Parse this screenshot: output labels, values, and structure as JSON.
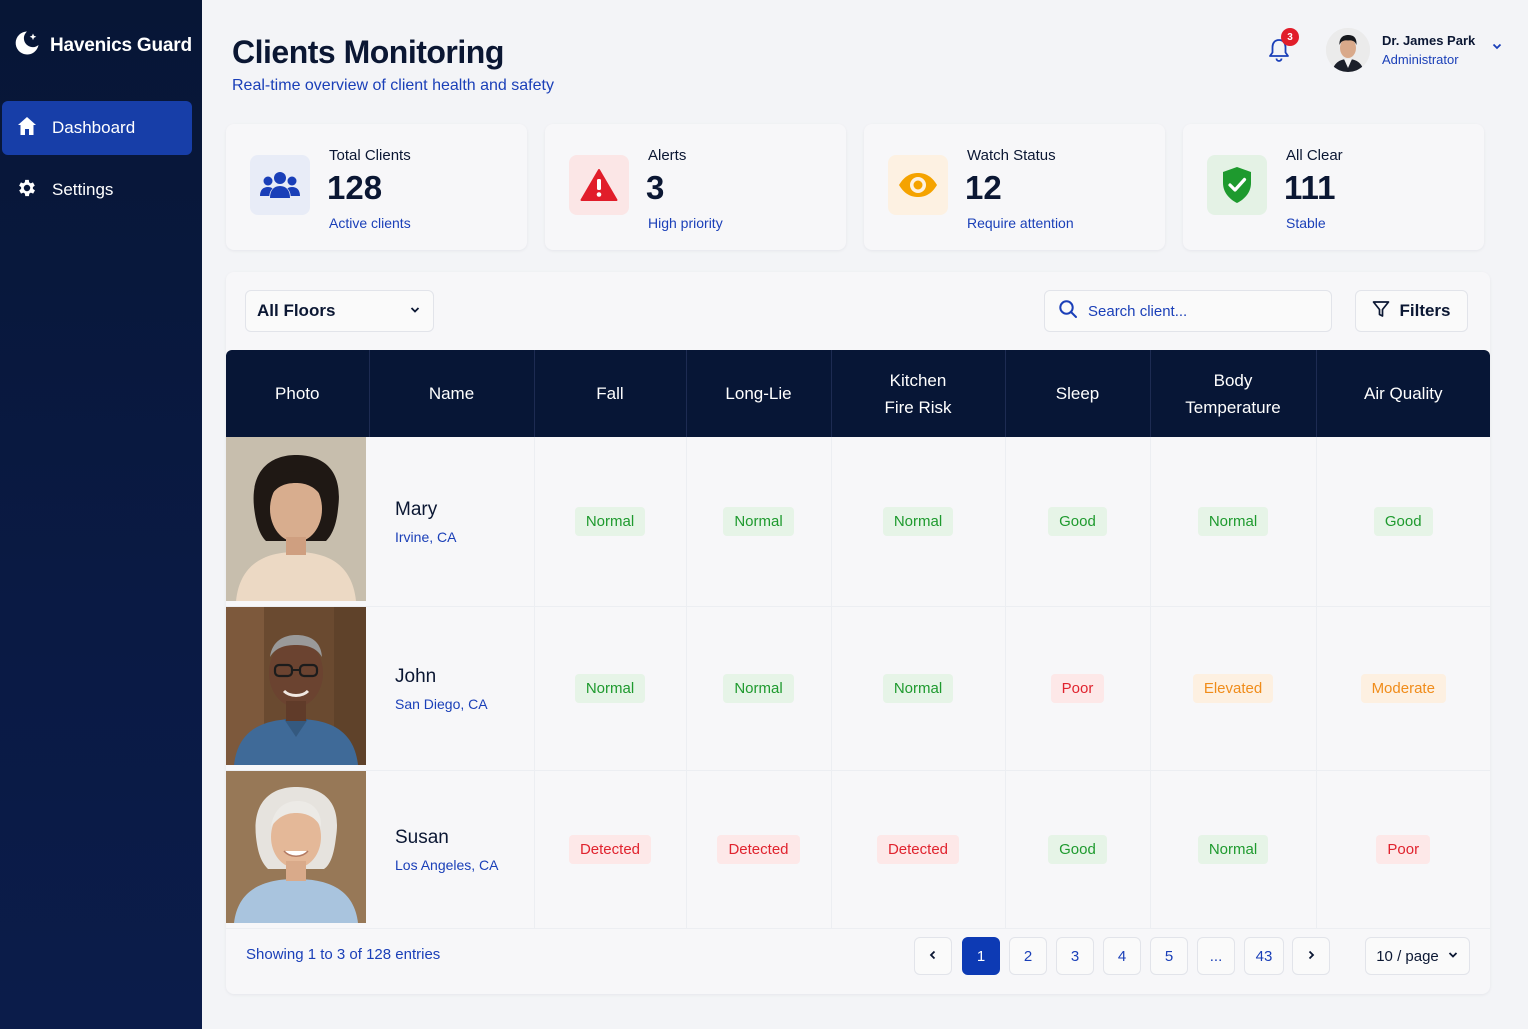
{
  "brand": {
    "name": "Havenics Guard"
  },
  "sidebar": {
    "items": [
      {
        "label": "Dashboard",
        "icon": "home-icon",
        "active": true
      },
      {
        "label": "Settings",
        "icon": "gear-icon",
        "active": false
      }
    ]
  },
  "header": {
    "title": "Clients Monitoring",
    "subtitle": "Real-time overview of client health and safety",
    "notifications_count": "3",
    "user": {
      "name": "Dr. James Park",
      "role": "Administrator"
    }
  },
  "stats": [
    {
      "label": "Total Clients",
      "value": "128",
      "sub": "Active clients",
      "icon": "users-icon",
      "color": "#1a3fb8"
    },
    {
      "label": "Alerts",
      "value": "3",
      "sub": "High priority",
      "icon": "warning-icon",
      "color": "#e11d2a"
    },
    {
      "label": "Watch Status",
      "value": "12",
      "sub": "Require attention",
      "icon": "eye-icon",
      "color": "#f5a300"
    },
    {
      "label": "All Clear",
      "value": "111",
      "sub": "Stable",
      "icon": "shield-check-icon",
      "color": "#1e9a2e"
    }
  ],
  "toolbar": {
    "floor_value": "All Floors",
    "search_placeholder": "Search client...",
    "filters_label": "Filters"
  },
  "table": {
    "columns": [
      "Photo",
      "Name",
      "Fall",
      "Long-Lie",
      "Kitchen\nFire Risk",
      "Sleep",
      "Body\nTemperature",
      "Air Quality"
    ],
    "rows": [
      {
        "name": "Mary",
        "location": "Irvine, CA",
        "values": [
          "Normal",
          "Normal",
          "Normal",
          "Good",
          "Normal",
          "Good"
        ],
        "status": [
          "green",
          "green",
          "green",
          "green",
          "green",
          "green"
        ]
      },
      {
        "name": "John",
        "location": "San Diego, CA",
        "values": [
          "Normal",
          "Normal",
          "Normal",
          "Poor",
          "Elevated",
          "Moderate"
        ],
        "status": [
          "green",
          "green",
          "green",
          "red",
          "orange",
          "orange"
        ]
      },
      {
        "name": "Susan",
        "location": "Los Angeles, CA",
        "values": [
          "Detected",
          "Detected",
          "Detected",
          "Good",
          "Normal",
          "Poor"
        ],
        "status": [
          "red",
          "red",
          "red",
          "green",
          "green",
          "red"
        ]
      }
    ]
  },
  "pagination": {
    "showing": "Showing 1 to 3 of 128 entries",
    "pages": [
      "1",
      "2",
      "3",
      "4",
      "5",
      "...",
      "43"
    ],
    "current": "1",
    "per_page": "10 / page"
  },
  "colors": {
    "sidebar_bg": "#071636",
    "accent": "#1a3fb8",
    "active_nav": "#173ea8",
    "good": "#1e9a2e",
    "bad": "#e0232e",
    "warn": "#f08c1a"
  }
}
